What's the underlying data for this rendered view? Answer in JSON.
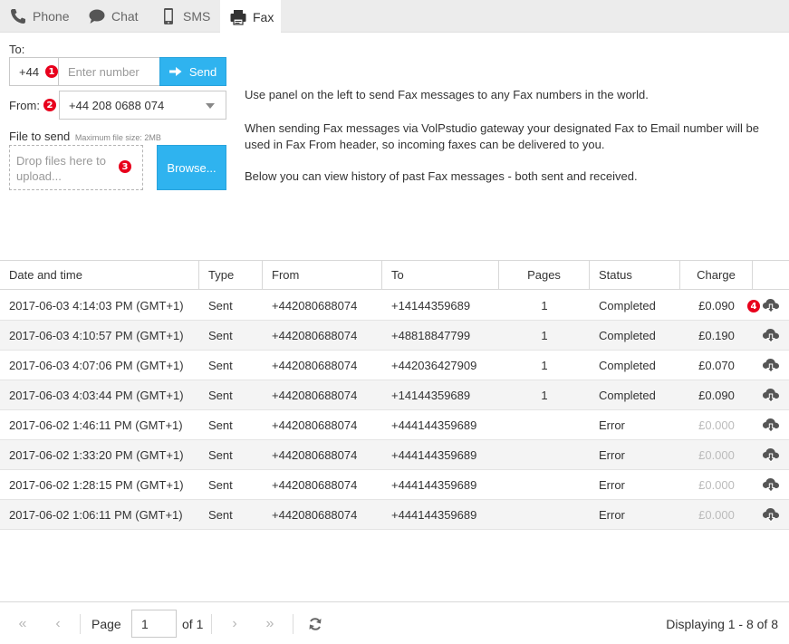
{
  "tabs": [
    {
      "label": "Phone",
      "icon": "phone-icon"
    },
    {
      "label": "Chat",
      "icon": "chat-icon"
    },
    {
      "label": "SMS",
      "icon": "mobile-icon"
    },
    {
      "label": "Fax",
      "icon": "fax-icon",
      "active": true
    }
  ],
  "form": {
    "to_label": "To:",
    "country_code": "+44",
    "number_placeholder": "Enter number",
    "send_label": "Send",
    "from_label": "From:",
    "from_value": "+44 208 0688 074",
    "file_label": "File to send",
    "file_hint": "Maximum file size: 2MB",
    "drop_text": "Drop files here to upload...",
    "browse_label": "Browse..."
  },
  "badges": [
    "1",
    "2",
    "3",
    "4"
  ],
  "info": {
    "p1": "Use panel on the left to send Fax messages to any Fax numbers in the world.",
    "p2": "When sending Fax messages via VolPstudio gateway your designated Fax to Email number will be used in Fax From header, so incoming faxes can be delivered to you.",
    "p3": "Below you can view history of past Fax messages - both sent and received."
  },
  "table": {
    "columns": [
      "Date and time",
      "Type",
      "From",
      "To",
      "Pages",
      "Status",
      "Charge"
    ],
    "rows": [
      {
        "datetime": "2017-06-03 4:14:03 PM (GMT+1)",
        "type": "Sent",
        "from": "+442080688074",
        "to": "+14144359689",
        "pages": "1",
        "status": "Completed",
        "charge": "£0.090",
        "muted": false
      },
      {
        "datetime": "2017-06-03 4:10:57 PM (GMT+1)",
        "type": "Sent",
        "from": "+442080688074",
        "to": "+48818847799",
        "pages": "1",
        "status": "Completed",
        "charge": "£0.190",
        "muted": false
      },
      {
        "datetime": "2017-06-03 4:07:06 PM (GMT+1)",
        "type": "Sent",
        "from": "+442080688074",
        "to": "+442036427909",
        "pages": "1",
        "status": "Completed",
        "charge": "£0.070",
        "muted": false
      },
      {
        "datetime": "2017-06-03 4:03:44 PM (GMT+1)",
        "type": "Sent",
        "from": "+442080688074",
        "to": "+14144359689",
        "pages": "1",
        "status": "Completed",
        "charge": "£0.090",
        "muted": false
      },
      {
        "datetime": "2017-06-02 1:46:11 PM (GMT+1)",
        "type": "Sent",
        "from": "+442080688074",
        "to": "+444144359689",
        "pages": "",
        "status": "Error",
        "charge": "£0.000",
        "muted": true
      },
      {
        "datetime": "2017-06-02 1:33:20 PM (GMT+1)",
        "type": "Sent",
        "from": "+442080688074",
        "to": "+444144359689",
        "pages": "",
        "status": "Error",
        "charge": "£0.000",
        "muted": true
      },
      {
        "datetime": "2017-06-02 1:28:15 PM (GMT+1)",
        "type": "Sent",
        "from": "+442080688074",
        "to": "+444144359689",
        "pages": "",
        "status": "Error",
        "charge": "£0.000",
        "muted": true
      },
      {
        "datetime": "2017-06-02 1:06:11 PM (GMT+1)",
        "type": "Sent",
        "from": "+442080688074",
        "to": "+444144359689",
        "pages": "",
        "status": "Error",
        "charge": "£0.000",
        "muted": true
      }
    ]
  },
  "pager": {
    "page_label": "Page",
    "page_value": "1",
    "of_label": "of 1",
    "displaying": "Displaying 1 - 8 of 8"
  },
  "colors": {
    "accent": "#2fb3ef",
    "badge": "#e8001c",
    "tabbar": "#ececec"
  }
}
